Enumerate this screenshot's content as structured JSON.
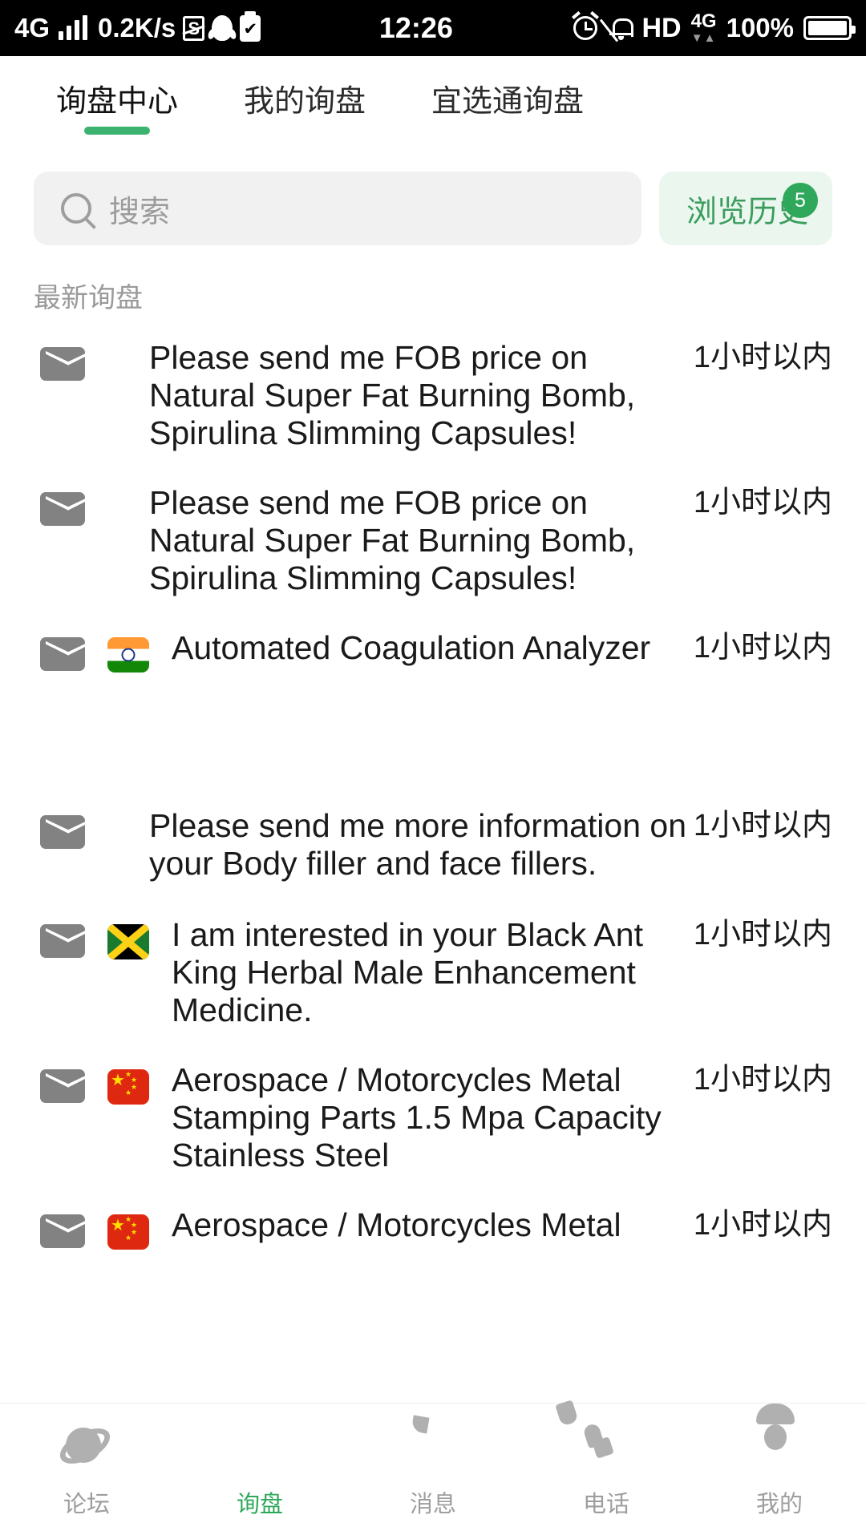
{
  "statusbar": {
    "network": "4G",
    "speed": "0.2K/s",
    "icons_left": [
      "signal-icon",
      "s-app-icon",
      "qq-icon",
      "clipboard-check-icon"
    ],
    "time": "12:26",
    "alarm": "alarm-icon",
    "mute": "bell-muted-icon",
    "hd": "HD",
    "network2": "4G",
    "battery_percent": "100%"
  },
  "tabs": [
    {
      "label": "询盘中心",
      "active": true
    },
    {
      "label": "我的询盘",
      "active": false
    },
    {
      "label": "宜选通询盘",
      "active": false
    }
  ],
  "search": {
    "placeholder": "搜索",
    "icon": "search-icon"
  },
  "history_button": {
    "label": "浏览历史",
    "badge": "5"
  },
  "section": {
    "label": "最新询盘"
  },
  "colors": {
    "accent_green": "#3cb371",
    "badge_green": "#2fa85c",
    "history_bg": "#eaf6ee",
    "search_bg": "#f1f1f1",
    "muted_text": "#9a9a9a"
  },
  "inquiries": [
    {
      "icon": "envelope-icon",
      "flag": "none",
      "title": "Please send me FOB price on Natural Super Fat Burning Bomb, Spirulina Slimming Capsules!",
      "time": "1小时以内"
    },
    {
      "icon": "envelope-icon",
      "flag": "none",
      "title": "Please send me FOB price on Natural Super Fat Burning Bomb, Spirulina Slimming Capsules!",
      "time": "1小时以内"
    },
    {
      "icon": "envelope-icon",
      "flag": "india-flag-icon",
      "title": "Automated Coagulation Analyzer",
      "time": "1小时以内"
    },
    {
      "icon": "envelope-icon",
      "flag": "none",
      "title": "Please send me more information on your Body filler and face fillers.",
      "time": "1小时以内"
    },
    {
      "icon": "envelope-icon",
      "flag": "jamaica-flag-icon",
      "title": "I am interested in your Black Ant King Herbal Male Enhancement Medicine.",
      "time": "1小时以内"
    },
    {
      "icon": "envelope-icon",
      "flag": "china-flag-icon",
      "title": "Aerospace / Motorcycles Metal Stamping Parts 1.5 Mpa Capacity Stainless Steel",
      "time": "1小时以内"
    },
    {
      "icon": "envelope-icon",
      "flag": "china-flag-icon",
      "title": "Aerospace / Motorcycles Metal",
      "time": "1小时以内"
    }
  ],
  "bottomnav": [
    {
      "label": "论坛",
      "icon": "forum-icon",
      "active": false
    },
    {
      "label": "询盘",
      "icon": "envelope-icon",
      "active": true
    },
    {
      "label": "消息",
      "icon": "chat-bubble-icon",
      "active": false
    },
    {
      "label": "电话",
      "icon": "phone-icon",
      "active": false
    },
    {
      "label": "我的",
      "icon": "user-icon",
      "active": false
    }
  ]
}
